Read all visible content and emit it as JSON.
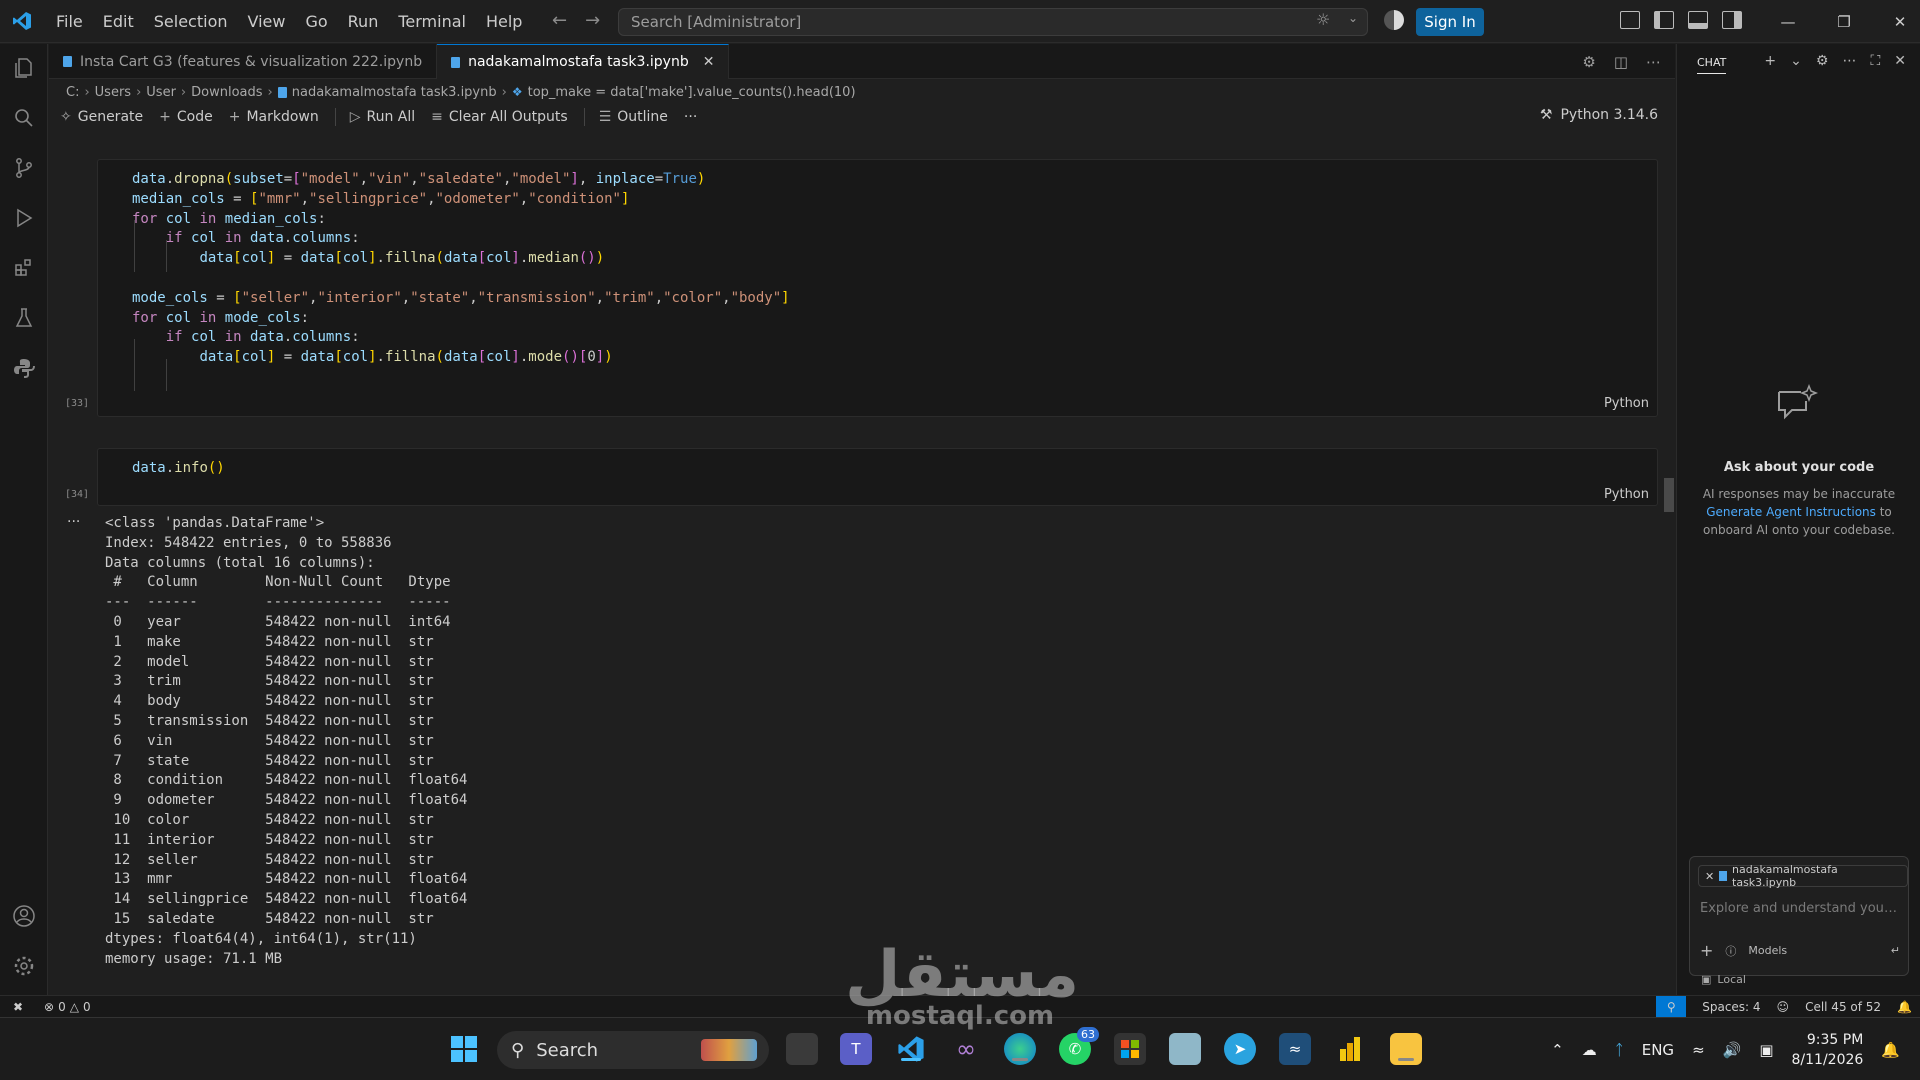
{
  "app": {
    "menu": [
      "File",
      "Edit",
      "Selection",
      "View",
      "Go",
      "Run",
      "Terminal",
      "Help"
    ],
    "search_placeholder": "Search [Administrator]",
    "sign_in": "Sign In"
  },
  "tabs": [
    {
      "label": "Insta Cart G3 (features & visualization 222.ipynb",
      "active": false
    },
    {
      "label": "nadakamalmostafa task3.ipynb",
      "active": true
    }
  ],
  "breadcrumb": [
    "C:",
    "Users",
    "User",
    "Downloads",
    "nadakamalmostafa task3.ipynb",
    "top_make = data['make'].value_counts().head(10)"
  ],
  "toolbar": {
    "generate": "Generate",
    "code": "Code",
    "markdown": "Markdown",
    "run_all": "Run All",
    "clear_outputs": "Clear All Outputs",
    "outline": "Outline",
    "more": "···",
    "kernel": "Python 3.14.6"
  },
  "cells": [
    {
      "exec_count": "[33]",
      "language": "Python"
    },
    {
      "exec_count": "[34]",
      "language": "Python"
    }
  ],
  "output": {
    "dots": "···",
    "lines": [
      "<class 'pandas.DataFrame'>",
      "Index: 548422 entries, 0 to 558836",
      "Data columns (total 16 columns):",
      " #   Column        Non-Null Count   Dtype  ",
      "---  ------        --------------   -----  ",
      " 0   year          548422 non-null  int64  ",
      " 1   make          548422 non-null  str    ",
      " 2   model         548422 non-null  str    ",
      " 3   trim          548422 non-null  str    ",
      " 4   body          548422 non-null  str    ",
      " 5   transmission  548422 non-null  str    ",
      " 6   vin           548422 non-null  str    ",
      " 7   state         548422 non-null  str    ",
      " 8   condition     548422 non-null  float64",
      " 9   odometer      548422 non-null  float64",
      " 10  color         548422 non-null  str    ",
      " 11  interior      548422 non-null  str    ",
      " 12  seller        548422 non-null  str    ",
      " 13  mmr           548422 non-null  float64",
      " 14  sellingprice  548422 non-null  float64",
      " 15  saledate      548422 non-null  str    ",
      "dtypes: float64(4), int64(1), str(11)",
      "memory usage: 71.1 MB"
    ]
  },
  "chat": {
    "tab": "CHAT",
    "ask_title": "Ask about your code",
    "disclaimer_1": "AI responses may be inaccurate",
    "disclaimer_link": "Generate Agent Instructions",
    "disclaimer_2": "to onboard AI onto your codebase.",
    "context_file": "nadakamalmostafa task3.ipynb",
    "input_placeholder": "Explore and understand your c...",
    "models": "Models",
    "local": "Local"
  },
  "statusbar": {
    "errors": "0",
    "warnings": "0",
    "spaces": "Spaces: 4",
    "cell": "Cell 45 of 52"
  },
  "taskbar": {
    "search": "Search",
    "whatsapp_badge": "63",
    "lang": "ENG",
    "time": "9:35 PM",
    "date": "8/11/2026"
  },
  "watermark": {
    "arabic": "مستقل",
    "latin": "mostaql.com"
  },
  "colors": {
    "accent": "#0078d4",
    "signin": "#0e639c",
    "keyword": "#c586c0",
    "function": "#dcdcaa",
    "string": "#ce9178",
    "boolean": "#569cd6"
  }
}
